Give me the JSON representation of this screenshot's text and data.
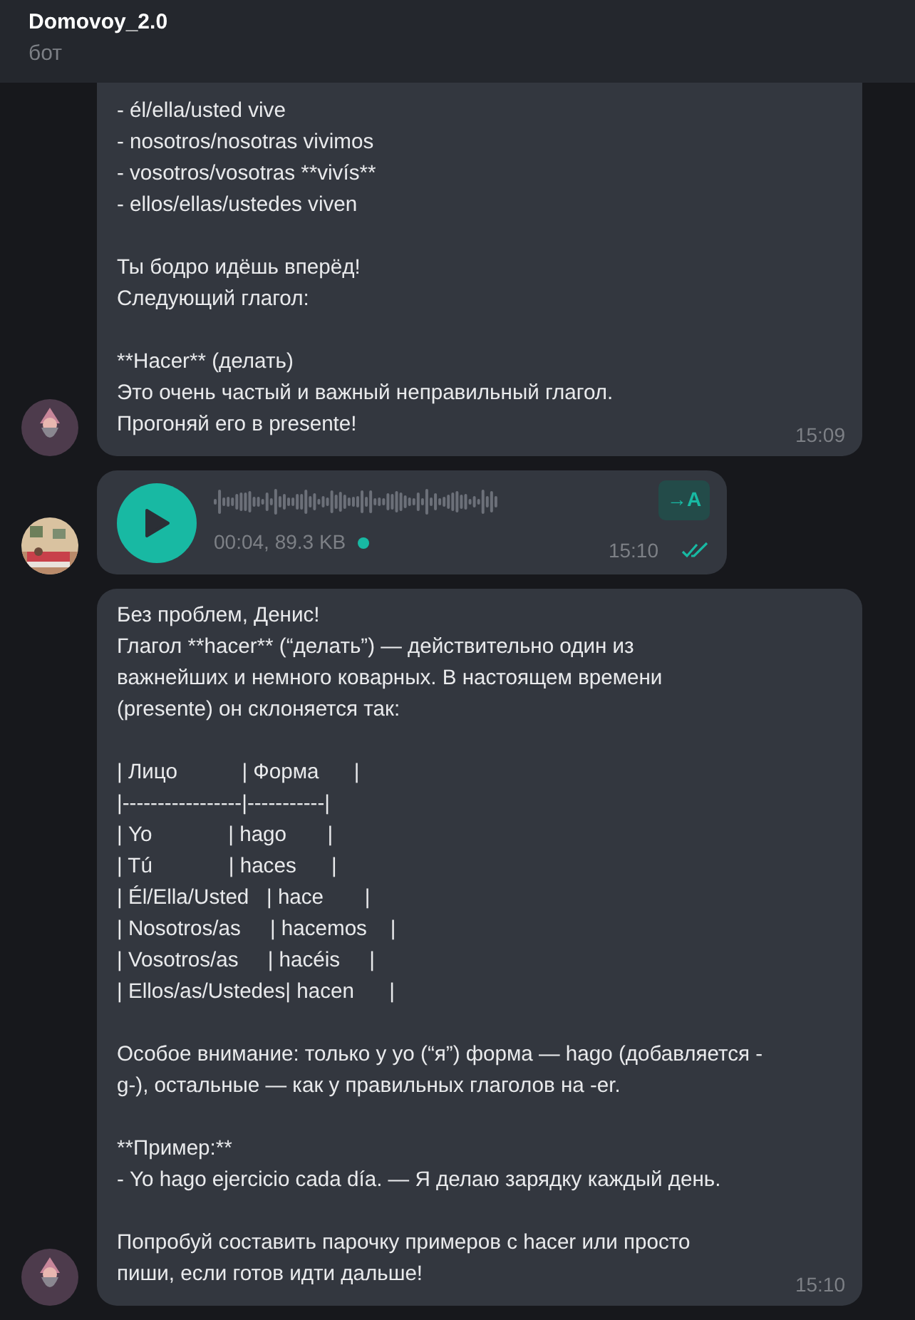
{
  "header": {
    "title": "Domovoy_2.0",
    "subtitle": "бот"
  },
  "messages": [
    {
      "kind": "text",
      "outgoing": false,
      "time": "15:09",
      "paragraphs": [
        {
          "lines": [
            "- él/ella/usted vive",
            "- nosotros/nosotras vivimos",
            "- vosotros/vosotras **vivís**",
            "- ellos/ellas/ustedes viven"
          ]
        },
        {
          "lines": [
            "Ты бодро идёшь вперёд!",
            "Следующий глагол:"
          ]
        },
        {
          "lines": [
            "**Hacer** (делать)",
            "Это очень частый и важный неправильный глагол.",
            "Прогоняй его в presente!"
          ]
        }
      ]
    },
    {
      "kind": "voice",
      "outgoing": true,
      "time": "15:10",
      "info": "00:04, 89.3 KB",
      "listened": false,
      "read": true,
      "transcribe_label": "→A"
    },
    {
      "kind": "text",
      "outgoing": false,
      "time": "15:10",
      "paragraphs": [
        {
          "lines": [
            "Без проблем, Денис!",
            "Глагол **hacer** (“делать”) — действительно один из",
            "важнейших и немного коварных. В настоящем времени",
            "(presente) он склоняется так:"
          ]
        },
        {
          "lines": [
            "| Лицо           | Форма      |",
            "|-----------------|-----------|",
            "| Yo             | hago       |",
            "| Tú             | haces      |",
            "| Él/Ella/Usted   | hace       |",
            "| Nosotros/as     | hacemos    |",
            "| Vosotros/as     | hacéis     |",
            "| Ellos/as/Ustedes| hacen      |"
          ]
        },
        {
          "lines": [
            "Особое внимание: только у yo (“я”) форма — hago (добавляется -",
            "g-), остальные — как у правильных глаголов на -er."
          ]
        },
        {
          "lines": [
            "**Пример:**",
            "- Yo hago ejercicio cada día. — Я делаю зарядку каждый день."
          ]
        },
        {
          "lines": [
            "Попробуй составить парочку примеров с hacer или просто",
            "пиши, если готов идти дальше!"
          ]
        }
      ]
    }
  ]
}
